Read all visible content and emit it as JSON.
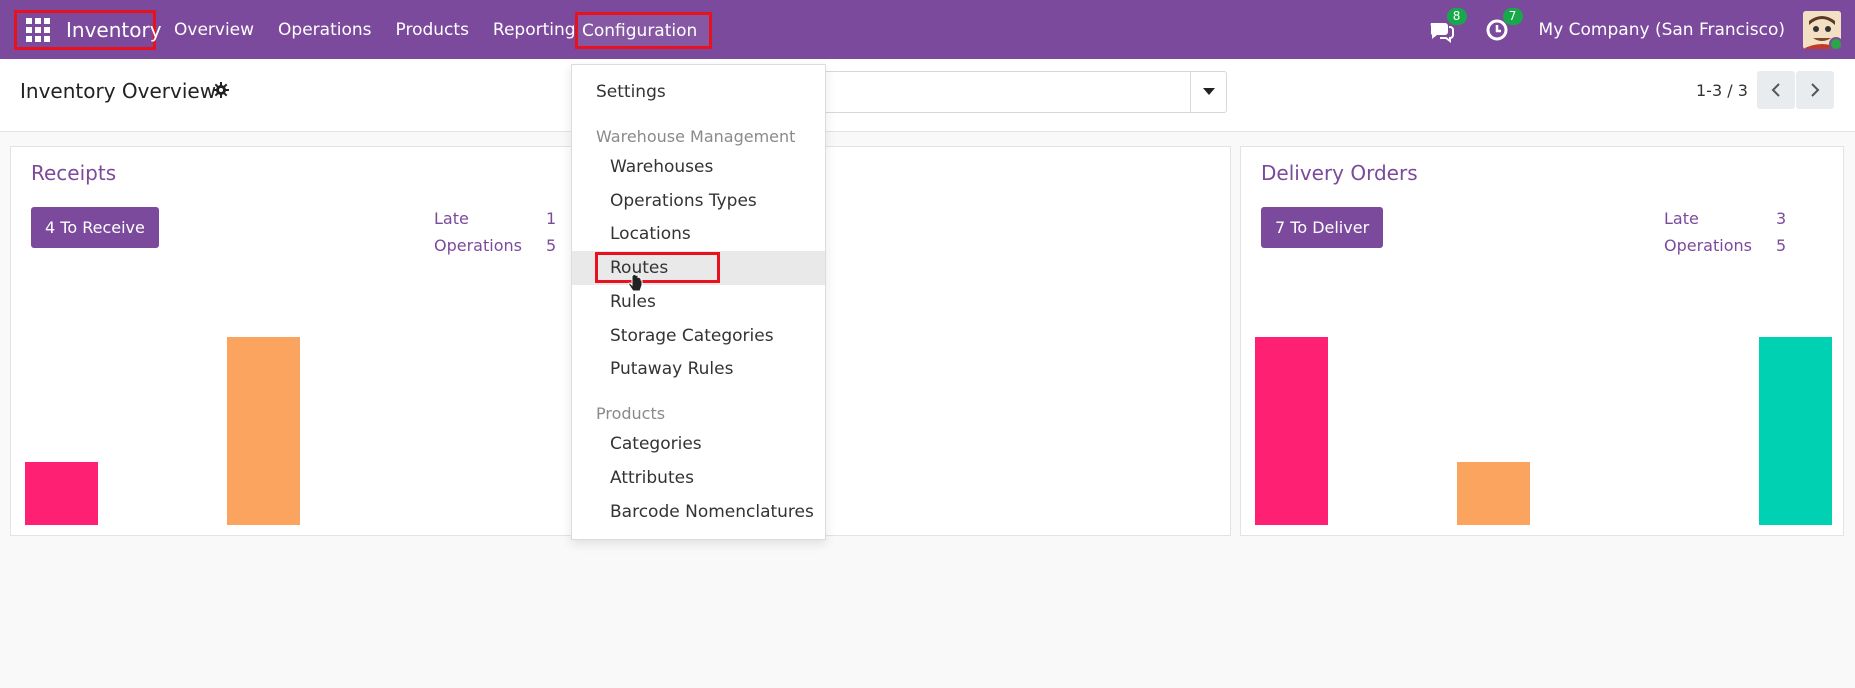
{
  "navbar": {
    "app_name": "Inventory",
    "menu": [
      "Overview",
      "Operations",
      "Products",
      "Reporting"
    ],
    "configuration": "Configuration",
    "messages_count": "8",
    "activities_count": "7",
    "company": "My Company (San Francisco)"
  },
  "control_panel": {
    "title": "Inventory Overview",
    "pager": "1-3 / 3"
  },
  "cards": {
    "receipts": {
      "title": "Receipts",
      "button": "4 To Receive",
      "late_label": "Late",
      "late_value": "1",
      "ops_label": "Operations",
      "ops_value": "5"
    },
    "delivery": {
      "title": "Delivery Orders",
      "button": "7 To Deliver",
      "late_label": "Late",
      "late_value": "3",
      "ops_label": "Operations",
      "ops_value": "5"
    }
  },
  "dropdown": {
    "settings": "Settings",
    "warehouse_header": "Warehouse Management",
    "warehouse_items": [
      "Warehouses",
      "Operations Types",
      "Locations",
      "Routes",
      "Rules",
      "Storage Categories",
      "Putaway Rules"
    ],
    "products_header": "Products",
    "products_items": [
      "Categories",
      "Attributes",
      "Barcode Nomenclatures"
    ]
  },
  "colors": {
    "brand": "#7c4a9c",
    "highlight": "#e8121f",
    "bar_pink": "#fe2072",
    "bar_orange": "#fba45f",
    "bar_teal": "#00d1b2"
  }
}
